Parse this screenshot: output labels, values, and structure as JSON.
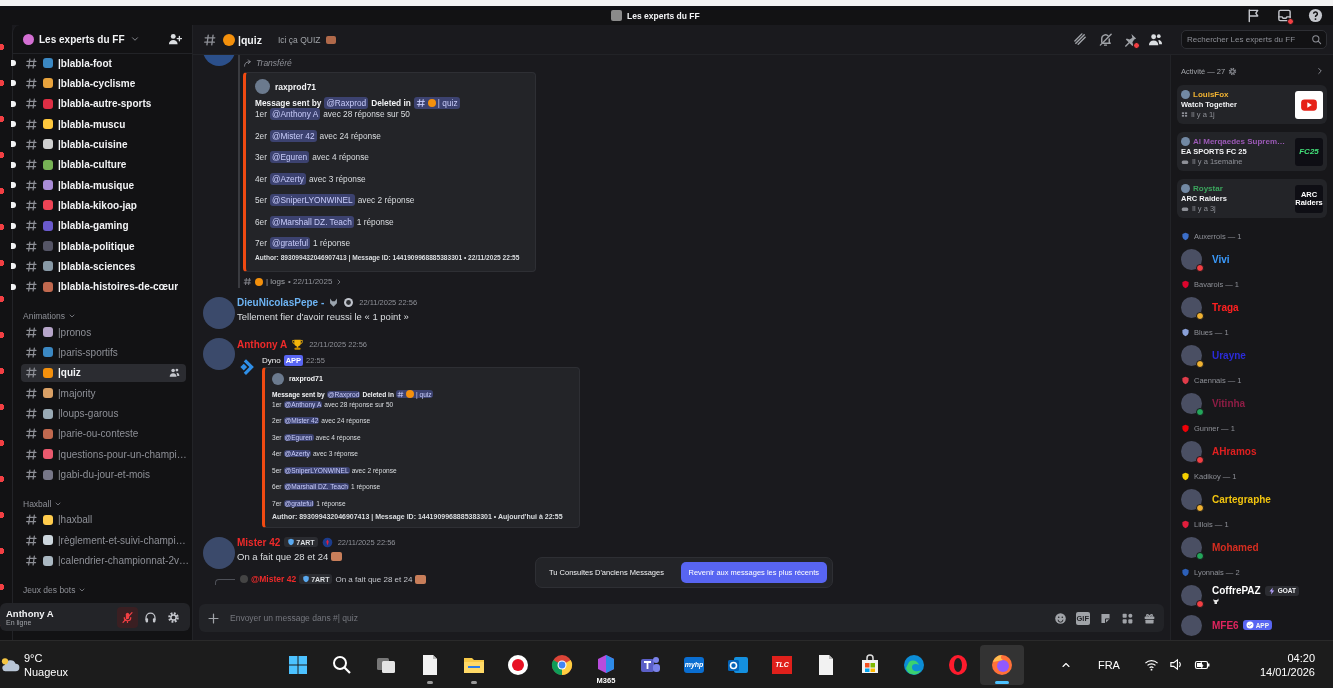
{
  "titlebar": {
    "title": "Les experts du FF"
  },
  "server": {
    "name": "Les experts du FF"
  },
  "channel_groups": [
    {
      "channels": [
        {
          "name": "|blabla-foot",
          "unread": true,
          "selected": false,
          "color": "#3b88c3"
        },
        {
          "name": "|blabla-cyclisme",
          "unread": true,
          "selected": false,
          "color": "#e8a33d"
        },
        {
          "name": "|blabla-autre-sports",
          "unread": true,
          "selected": false,
          "color": "#dd2e44"
        },
        {
          "name": "|blabla-muscu",
          "unread": true,
          "selected": false,
          "color": "#ffc83d"
        },
        {
          "name": "|blabla-cuisine",
          "unread": true,
          "selected": false,
          "color": "#d0d0d0"
        },
        {
          "name": "|blabla-culture",
          "unread": true,
          "selected": false,
          "color": "#77b255"
        },
        {
          "name": "|blabla-musique",
          "unread": true,
          "selected": false,
          "color": "#aa8dd8"
        },
        {
          "name": "|blabla-kikoo-jap",
          "unread": true,
          "selected": false,
          "color": "#ee4455"
        },
        {
          "name": "|blabla-gaming",
          "unread": true,
          "selected": false,
          "color": "#6a5acd"
        },
        {
          "name": "|blabla-politique",
          "unread": true,
          "selected": false,
          "color": "#555566"
        },
        {
          "name": "|blabla-sciences",
          "unread": true,
          "selected": false,
          "color": "#8899a6"
        },
        {
          "name": "|blabla-histoires-de-cœur",
          "unread": true,
          "selected": false,
          "color": "#c1694f"
        }
      ]
    },
    {
      "category": "Animations",
      "channels": [
        {
          "name": "|pronos",
          "unread": false,
          "selected": false,
          "color": "#b6a5c9"
        },
        {
          "name": "|paris-sportifs",
          "unread": false,
          "selected": false,
          "color": "#3b88c3"
        },
        {
          "name": "|quiz",
          "unread": false,
          "selected": true,
          "color": "#f4900c"
        },
        {
          "name": "|majority",
          "unread": false,
          "selected": false,
          "color": "#d9a066"
        },
        {
          "name": "|loups-garous",
          "unread": false,
          "selected": false,
          "color": "#99aab5"
        },
        {
          "name": "|parie-ou-conteste",
          "unread": false,
          "selected": false,
          "color": "#c1694f"
        },
        {
          "name": "|questions-pour-un-champi…",
          "unread": false,
          "selected": false,
          "color": "#ea596e"
        },
        {
          "name": "|gabi-du-jour-et-mois",
          "unread": false,
          "selected": false,
          "color": "#777788"
        }
      ]
    },
    {
      "category": "Haxball",
      "channels": [
        {
          "name": "|haxball",
          "unread": false,
          "selected": false,
          "color": "#ffcc4d"
        },
        {
          "name": "|règlement-et-suivi-champi…",
          "unread": false,
          "selected": false,
          "color": "#ccd6dd"
        },
        {
          "name": "|calendrier-championnat-2v…",
          "unread": false,
          "selected": false,
          "color": "#aab8c2"
        }
      ]
    },
    {
      "category": "Jeux des bots"
    }
  ],
  "user_panel": {
    "name": "Anthony A",
    "status": "En ligne",
    "muted": true
  },
  "header": {
    "channel": "|quiz",
    "topic": "Ici ça QUIZ",
    "search": {
      "placeholder": "Rechercher Les experts du FF"
    }
  },
  "messages": [
    {
      "kind": "forwarded",
      "label": "Transféré",
      "embed": {
        "author": "raxprod71",
        "header": [
          {
            "kind": "bold",
            "text": "Message sent by"
          },
          {
            "kind": "mention",
            "text": "@Raxprod"
          },
          {
            "kind": "bold",
            "text": "Deleted in"
          },
          {
            "kind": "channel",
            "text": "| quiz"
          }
        ],
        "lines": [
          [
            {
              "kind": "text",
              "text": "1er"
            },
            {
              "kind": "mention",
              "text": "@Anthony A"
            },
            {
              "kind": "text",
              "text": "avec 28 réponse sur 50"
            }
          ],
          [
            {
              "kind": "text",
              "text": "2er"
            },
            {
              "kind": "mention",
              "text": "@Mister 42"
            },
            {
              "kind": "text",
              "text": "avec 24 réponse"
            }
          ],
          [
            {
              "kind": "text",
              "text": "3er"
            },
            {
              "kind": "mention",
              "text": "@Eguren"
            },
            {
              "kind": "text",
              "text": "avec 4 réponse"
            }
          ],
          [
            {
              "kind": "text",
              "text": "4er"
            },
            {
              "kind": "mention",
              "text": "@Azerty"
            },
            {
              "kind": "text",
              "text": "avec 3 réponse"
            }
          ],
          [
            {
              "kind": "text",
              "text": "5er"
            },
            {
              "kind": "mention",
              "text": "@SniperLYONWINEL"
            },
            {
              "kind": "text",
              "text": "avec 2 réponse"
            }
          ],
          [
            {
              "kind": "text",
              "text": "6er"
            },
            {
              "kind": "mention",
              "text": "@Marshall DZ. Teach"
            },
            {
              "kind": "text",
              "text": "1 réponse"
            }
          ],
          [
            {
              "kind": "text",
              "text": "7er"
            },
            {
              "kind": "mention",
              "text": "@grateful"
            },
            {
              "kind": "text",
              "text": "1 réponse"
            }
          ]
        ],
        "footer": "Author: 893099432046907413 | Message ID: 1441909968885383301 • 22/11/2025 22:55"
      },
      "source": {
        "channel": "| logs",
        "date": "• 22/11/2025"
      }
    },
    {
      "kind": "message",
      "author": "DieuNicolasPepe -",
      "color": "#6db3f2",
      "name_icons": [
        {
          "kind": "wolf"
        },
        {
          "kind": "badge"
        }
      ],
      "time": "22/11/2025 22:56",
      "text": "Tellement fier d'avoir reussi le « 1 point »"
    },
    {
      "kind": "message",
      "author": "Anthony A",
      "color": "#ee2a2a",
      "name_icons": [
        {
          "kind": "trophy"
        }
      ],
      "time": "22/11/2025 22:56",
      "app_post": {
        "author": "Dyno",
        "tag": "APP",
        "time": "22:55",
        "embed": {
          "author": "raxprod71",
          "header": [
            {
              "kind": "bold",
              "text": "Message sent by"
            },
            {
              "kind": "mention",
              "text": "@Raxprod"
            },
            {
              "kind": "bold",
              "text": "Deleted in"
            },
            {
              "kind": "channel",
              "text": "| quiz"
            }
          ],
          "lines": [
            [
              {
                "kind": "text",
                "text": "1er"
              },
              {
                "kind": "mention",
                "text": "@Anthony A"
              },
              {
                "kind": "text",
                "text": "avec 28 réponse sur 50"
              }
            ],
            [
              {
                "kind": "text",
                "text": "2er"
              },
              {
                "kind": "mention",
                "text": "@Mister 42"
              },
              {
                "kind": "text",
                "text": "avec 24 réponse"
              }
            ],
            [
              {
                "kind": "text",
                "text": "3er"
              },
              {
                "kind": "mention",
                "text": "@Eguren"
              },
              {
                "kind": "text",
                "text": "avec 4 réponse"
              }
            ],
            [
              {
                "kind": "text",
                "text": "4er"
              },
              {
                "kind": "mention",
                "text": "@Azerty"
              },
              {
                "kind": "text",
                "text": "avec 3 réponse"
              }
            ],
            [
              {
                "kind": "text",
                "text": "5er"
              },
              {
                "kind": "mention",
                "text": "@SniperLYONWINEL"
              },
              {
                "kind": "text",
                "text": "avec 2 réponse"
              }
            ],
            [
              {
                "kind": "text",
                "text": "6er"
              },
              {
                "kind": "mention",
                "text": "@Marshall DZ. Teach"
              },
              {
                "kind": "text",
                "text": "1 réponse"
              }
            ],
            [
              {
                "kind": "text",
                "text": "7er"
              },
              {
                "kind": "mention",
                "text": "@grateful"
              },
              {
                "kind": "text",
                "text": "1 réponse"
              }
            ]
          ],
          "footer": "Author: 893099432046907413 | Message ID: 1441909968885383301 • Aujourd'hui à 22:55"
        }
      }
    },
    {
      "kind": "message",
      "author": "Mister 42",
      "color": "#ee2a2a",
      "tag": "7ART",
      "name_icons": [
        {
          "kind": "crest"
        }
      ],
      "time": "22/11/2025 22:56",
      "text": "On a fait que 28 et 24",
      "trailing_emoji": true
    },
    {
      "kind": "reply_preview",
      "author": "@Mister 42",
      "color": "#ee2a2a",
      "tag": "7ART",
      "text": "On a fait que 28 et 24",
      "trailing_emoji": true
    }
  ],
  "toast": {
    "text": "Tu Consultes D'anciens Messages",
    "button": "Revenir aux messages les plus récents"
  },
  "composer": {
    "placeholder": "Envoyer un message dans #| quiz",
    "buttons": [
      {
        "kind": "emoji"
      },
      {
        "kind": "gif",
        "label": "GIF"
      },
      {
        "kind": "sticker"
      },
      {
        "kind": "apps"
      },
      {
        "kind": "gift"
      }
    ]
  },
  "activity": {
    "label": "Activité — 27",
    "cards": [
      {
        "user": "LouisFox",
        "color": "#f0b232",
        "title": "Watch Together",
        "time": "Il y a 1j",
        "kind": "watch"
      },
      {
        "user": "Al Merqaedes Suprem…",
        "color": "#9b59b6",
        "title": "EA SPORTS FC 25",
        "time": "Il y a 1semaine",
        "kind": "game",
        "logo": "FC25"
      },
      {
        "user": "Roystar",
        "color": "#3ba55d",
        "title": "ARC Raiders",
        "time": "Il y a 3j",
        "kind": "game",
        "logo": "ARC Raiders"
      }
    ]
  },
  "member_groups": [
    {
      "name": "Auxerrois — 1",
      "color": "#3b6ec9",
      "members": [
        {
          "name": "Vivi",
          "color": "#3b9cff",
          "status_dot": {
            "color": "#f23f43"
          }
        }
      ]
    },
    {
      "name": "Bavarois — 1",
      "color": "#dc052d",
      "members": [
        {
          "name": "Traga",
          "color": "#ff2020",
          "status_dot": {
            "color": "#f0b232"
          }
        }
      ]
    },
    {
      "name": "Blues — 1",
      "color": "#8aa0d8",
      "members": [
        {
          "name": "Urayne",
          "color": "#2b2bd8",
          "status_dot": {
            "color": "#f0b232"
          }
        }
      ]
    },
    {
      "name": "Caennais — 1",
      "color": "#e03c4a",
      "members": [
        {
          "name": "Vitinha",
          "color": "#8e1d45",
          "status_dot": {
            "color": "#23a55a"
          }
        }
      ]
    },
    {
      "name": "Gunner — 1",
      "color": "#ef0107",
      "members": [
        {
          "name": "AHramos",
          "color": "#e02020",
          "status_dot": {
            "color": "#f23f43"
          }
        }
      ]
    },
    {
      "name": "Kadikoy — 1",
      "color": "#f5d000",
      "members": [
        {
          "name": "Cartegraphe",
          "color": "#f1c40f",
          "status_dot": {
            "color": "#f0b232"
          }
        }
      ]
    },
    {
      "name": "Lillois — 1",
      "color": "#e01e3c",
      "members": [
        {
          "name": "Mohamed",
          "color": "#d62d20",
          "status_dot": {
            "color": "#23a55a"
          }
        }
      ]
    },
    {
      "name": "Lyonnais — 2",
      "color": "#2c5fb8",
      "members": [
        {
          "name": "CoffrePAZ",
          "color": "#ffffff",
          "status_dot": {
            "color": "#f23f43"
          },
          "tag": {
            "kind": "bolt",
            "text": "GOAT"
          },
          "custom_status": true
        },
        {
          "name": "MFE6",
          "color": "#e0245e",
          "tag": {
            "kind": "verified",
            "text": "APP"
          }
        }
      ]
    }
  ],
  "taskbar": {
    "weather": {
      "temp": "9°C",
      "condition": "Nuageux"
    },
    "apps": [
      {
        "kind": "start",
        "running": false,
        "active": false
      },
      {
        "kind": "search",
        "running": false,
        "active": false
      },
      {
        "kind": "taskview",
        "running": false,
        "active": false
      },
      {
        "kind": "notepad",
        "running": true,
        "active": false
      },
      {
        "kind": "explorer",
        "running": true,
        "active": false
      },
      {
        "kind": "recorder",
        "running": false,
        "active": false
      },
      {
        "kind": "chrome",
        "running": false,
        "active": false
      },
      {
        "kind": "m365",
        "label": "M365",
        "running": false,
        "active": false
      },
      {
        "kind": "teams",
        "running": false,
        "active": false
      },
      {
        "kind": "myhp",
        "label": "myhp",
        "running": false,
        "active": false
      },
      {
        "kind": "outlook",
        "running": false,
        "active": false
      },
      {
        "kind": "tlc",
        "label": "TLC",
        "running": false,
        "active": false
      },
      {
        "kind": "file",
        "running": false,
        "active": false
      },
      {
        "kind": "store",
        "running": false,
        "active": false
      },
      {
        "kind": "edge",
        "running": false,
        "active": false
      },
      {
        "kind": "opera",
        "running": false,
        "active": false
      },
      {
        "kind": "firefox",
        "running": true,
        "active": true
      }
    ],
    "language": "FRA",
    "time": "04:20",
    "date": "14/01/2026"
  }
}
